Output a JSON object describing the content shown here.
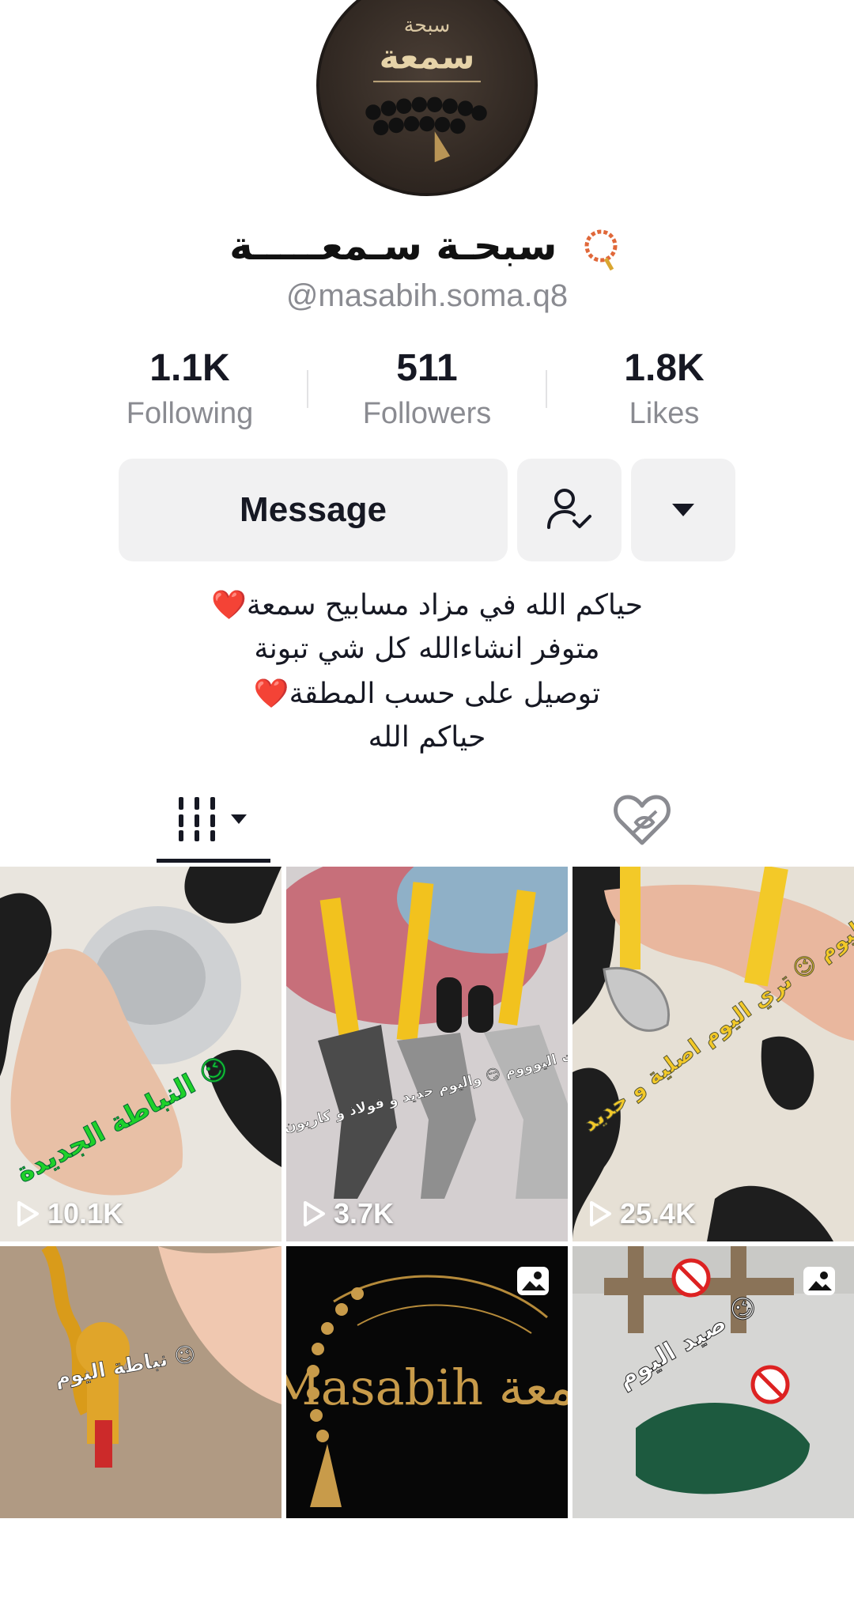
{
  "profile": {
    "avatar": {
      "line1": "سبحة",
      "line2": "سمعة"
    },
    "display_name": "سبحـة سـمعـــــة",
    "handle": "@masabih.soma.q8"
  },
  "stats": [
    {
      "value": "1.1K",
      "label": "Following"
    },
    {
      "value": "511",
      "label": "Followers"
    },
    {
      "value": "1.8K",
      "label": "Likes"
    }
  ],
  "actions": {
    "message_label": "Message",
    "follow_icon": "person-check-icon",
    "more_icon": "caret-down-icon"
  },
  "bio": [
    "حياكم الله في مزاد مسابيح سمعة❤️",
    "متوفر انشاءالله كل شي تبونة",
    "توصيل على حسب المطقة❤️",
    "حياكم الله"
  ],
  "tabs": {
    "videos_icon": "grid-icon",
    "liked_icon": "heart-hidden-icon"
  },
  "videos": [
    {
      "views": "10.1K",
      "caption": "النباطة الجديدة 😉"
    },
    {
      "views": "3.7K",
      "caption": "نباطات اليوووم 😏 واليوم حديد و فولاذ و كاربون فايبر"
    },
    {
      "views": "25.4K",
      "caption": "نباطة اليوم 😉 تري اليوم اصلية و حديد 😂"
    },
    {
      "caption": "نباطة اليوم 😉"
    },
    {
      "caption": "Masabih سمعة",
      "badge": "photo-icon"
    },
    {
      "caption": "صيد اليوم 😉",
      "badge": "photo-icon"
    }
  ]
}
